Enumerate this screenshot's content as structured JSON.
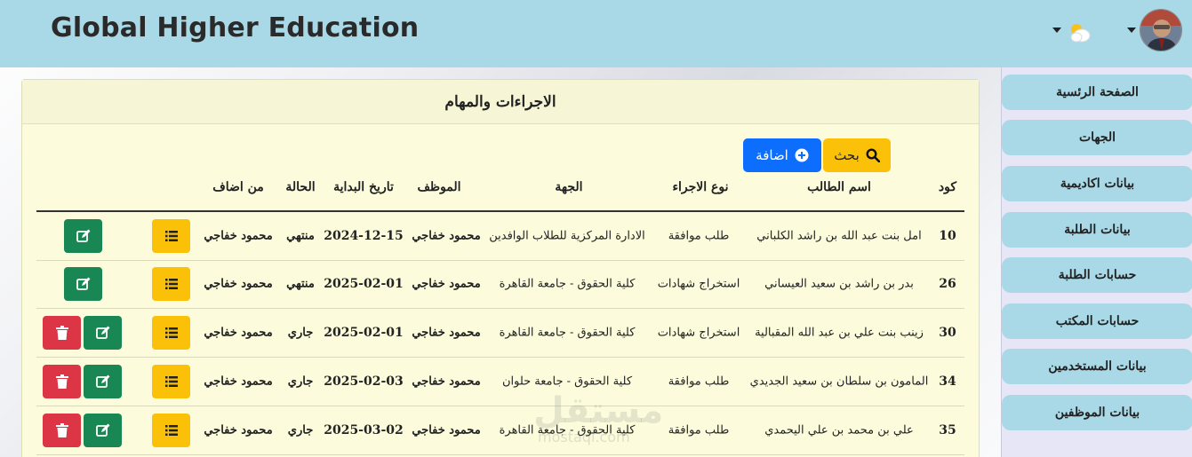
{
  "app": {
    "title": "Global Higher Education"
  },
  "card": {
    "title": "الاجراءات والمهام"
  },
  "toolbar": {
    "search_label": "بحث",
    "add_label": "اضافة"
  },
  "table": {
    "headers": {
      "code": "كود",
      "student": "اسم الطالب",
      "type": "نوع الاجراء",
      "entity": "الجهة",
      "employee": "الموظف",
      "start_date": "تاريخ البداية",
      "status": "الحالة",
      "added_by": "من اضاف"
    },
    "rows": [
      {
        "code": "10",
        "student": "امل بنت عبد الله بن راشد الكلباني",
        "type": "طلب موافقة",
        "entity": "الادارة المركزية للطلاب الوافدين",
        "employee": "محمود خفاجي",
        "start_date": "2024-12-15",
        "status": "منتهي",
        "added_by": "محمود خفاجي"
      },
      {
        "code": "26",
        "student": "بدر بن راشد بن سعيد العيساني",
        "type": "استخراج شهادات",
        "entity": "كلية الحقوق - جامعة القاهرة",
        "employee": "محمود خفاجي",
        "start_date": "2025-02-01",
        "status": "منتهي",
        "added_by": "محمود خفاجي"
      },
      {
        "code": "30",
        "student": "زينب بنت علي بن عبد الله المقبالية",
        "type": "استخراج شهادات",
        "entity": "كلية الحقوق - جامعة القاهرة",
        "employee": "محمود خفاجي",
        "start_date": "2025-02-01",
        "status": "جاري",
        "added_by": "محمود خفاجي"
      },
      {
        "code": "34",
        "student": "المامون بن سلطان بن سعيد الجديدي",
        "type": "طلب موافقة",
        "entity": "كلية الحقوق - جامعة حلوان",
        "employee": "محمود خفاجي",
        "start_date": "2025-02-03",
        "status": "جاري",
        "added_by": "محمود خفاجي"
      },
      {
        "code": "35",
        "student": "علي بن محمد بن علي اليحمدي",
        "type": "طلب موافقة",
        "entity": "كلية الحقوق - جامعة القاهرة",
        "employee": "محمود خفاجي",
        "start_date": "2025-03-02",
        "status": "جاري",
        "added_by": "محمود خفاجي"
      }
    ]
  },
  "sidebar": {
    "items": [
      {
        "label": "الصفحة الرئسية"
      },
      {
        "label": "الجهات"
      },
      {
        "label": "بيانات اكاديمية"
      },
      {
        "label": "بيانات الطلبة"
      },
      {
        "label": "حسابات الطلبة"
      },
      {
        "label": "حسابات المكتب"
      },
      {
        "label": "بيانات المستخدمين"
      },
      {
        "label": "بيانات الموظفين"
      }
    ]
  },
  "watermark": {
    "text": "مستقل",
    "sub": "mostaql.com"
  },
  "colors": {
    "topbar": "#a9d8e6",
    "sidebar_bg": "#e6e6f6",
    "card_bg": "#fcfcdc",
    "warning": "#fbc108",
    "primary": "#0d6efd",
    "success": "#198754",
    "danger": "#dc3545"
  }
}
